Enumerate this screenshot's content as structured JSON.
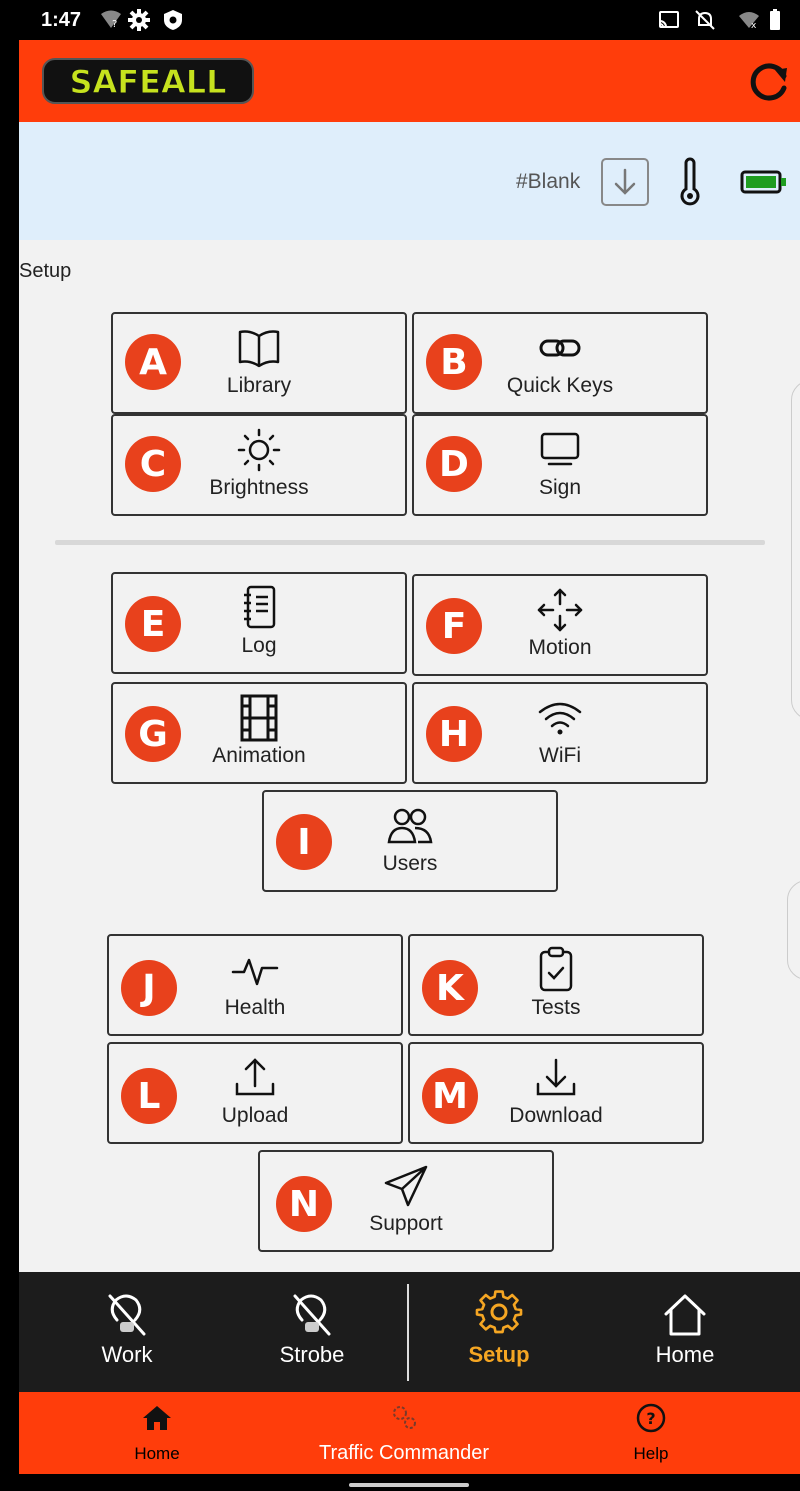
{
  "status_bar": {
    "time": "1:47"
  },
  "app": {
    "logo_text": "SAFEALL"
  },
  "info_bar": {
    "sign_name": "#Blank"
  },
  "section_title": "Setup",
  "tiles": [
    {
      "badge": "A",
      "label": "Library",
      "icon": "book-icon"
    },
    {
      "badge": "B",
      "label": "Quick Keys",
      "icon": "link-icon"
    },
    {
      "badge": "C",
      "label": "Brightness",
      "icon": "sun-icon"
    },
    {
      "badge": "D",
      "label": "Sign",
      "icon": "monitor-icon"
    },
    {
      "badge": "E",
      "label": "Log",
      "icon": "notebook-icon"
    },
    {
      "badge": "F",
      "label": "Motion",
      "icon": "move-arrows-icon"
    },
    {
      "badge": "G",
      "label": "Animation",
      "icon": "film-icon"
    },
    {
      "badge": "H",
      "label": "WiFi",
      "icon": "wifi-icon"
    },
    {
      "badge": "I",
      "label": "Users",
      "icon": "users-icon"
    },
    {
      "badge": "J",
      "label": "Health",
      "icon": "pulse-icon"
    },
    {
      "badge": "K",
      "label": "Tests",
      "icon": "clipboard-check-icon"
    },
    {
      "badge": "L",
      "label": "Upload",
      "icon": "upload-icon"
    },
    {
      "badge": "M",
      "label": "Download",
      "icon": "download-icon"
    },
    {
      "badge": "N",
      "label": "Support",
      "icon": "send-icon"
    }
  ],
  "bottom_nav": [
    {
      "label": "Work",
      "icon": "work-light-off-icon",
      "active": false
    },
    {
      "label": "Strobe",
      "icon": "strobe-light-off-icon",
      "active": false
    },
    {
      "label": "Setup",
      "icon": "gear-icon",
      "active": true
    },
    {
      "label": "Home",
      "icon": "home-outline-icon",
      "active": false
    }
  ],
  "footer": [
    {
      "label": "Home",
      "icon": "home-icon"
    },
    {
      "label": "Traffic Commander",
      "icon": "gears-icon"
    },
    {
      "label": "Help",
      "icon": "help-circle-icon"
    }
  ],
  "colors": {
    "brand_orange": "#ff3d0b",
    "badge_red": "#e8411c",
    "active_nav": "#f5a623",
    "battery_green": "#1f9d20",
    "info_bar_bg": "#dfeefb"
  }
}
